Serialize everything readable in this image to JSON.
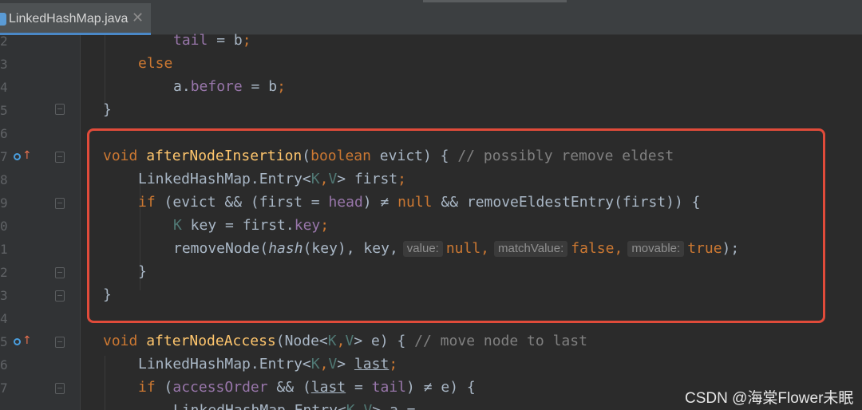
{
  "tab": {
    "title": "LinkedHashMap.java",
    "close_glyph": "✕",
    "icon": "java-class-icon"
  },
  "gutter": {
    "line_numbers": [
      "2",
      "3",
      "4",
      "5",
      "6",
      "7",
      "8",
      "9",
      "0",
      "1",
      "2",
      "3",
      "4",
      "5",
      "6",
      "7"
    ],
    "override_markers": [
      "override-marker-icon",
      "override-marker-icon"
    ]
  },
  "code": {
    "l1": {
      "t1": "tail",
      "t2": " = b",
      "t3": ";"
    },
    "l2": {
      "t1": "else"
    },
    "l3": {
      "t1": "a.",
      "t2": "before",
      "t3": " = b",
      "t4": ";"
    },
    "l4": {
      "t1": "}"
    },
    "l5": {
      "kw": "void ",
      "fn": "afterNodeInsertion",
      "t1": "(",
      "kw2": "boolean",
      "t2": " evict) { ",
      "cm": "// possibly remove eldest"
    },
    "l6": {
      "t1": "LinkedHashMap.Entry<",
      "tp1": "K",
      "t2": ",",
      "tp2": "V",
      "t3": "> first",
      "t4": ";"
    },
    "l7": {
      "kw": "if",
      "t1": " (evict && (first = ",
      "fld": "head",
      "t2": ") ≠ ",
      "kw2": "null",
      "t3": " && removeEldestEntry(first)) {"
    },
    "l8": {
      "tp": "K",
      "t1": " key = first.",
      "fld": "key",
      "t2": ";"
    },
    "l9": {
      "t1": "removeNode(",
      "it": "hash",
      "t2": "(key), key,",
      "hint1": "value:",
      "v1": "null,",
      "hint2": "matchValue:",
      "v2": "false,",
      "hint3": "movable:",
      "v3": "true",
      "t3": ");"
    },
    "l10": {
      "t1": "}"
    },
    "l11": {
      "t1": "}"
    },
    "l12": {
      "kw": "void ",
      "fn": "afterNodeAccess",
      "t1": "(Node<",
      "tp1": "K",
      "t2": ",",
      "tp2": "V",
      "t3": "> e) { ",
      "cm": "// move node to last"
    },
    "l13": {
      "t1": "LinkedHashMap.Entry<",
      "tp1": "K",
      "t2": ",",
      "tp2": "V",
      "t3": "> ",
      "ul": "last",
      "t4": ";"
    },
    "l14": {
      "kw": "if",
      "t1": " (",
      "fld": "accessOrder",
      "t2": " && (",
      "ul": "last",
      "t3": " = ",
      "fld2": "tail",
      "t4": ") ≠ e) {"
    },
    "l15": {
      "t1": "LinkedHashMap.Entry<",
      "tp1": "K",
      "t2": ",",
      "tp2": "V",
      "t3": "> a ="
    }
  },
  "colors": {
    "highlight_box": "#e04b3a",
    "keyword": "#cc7832",
    "method": "#ffc66d",
    "field": "#9876aa",
    "comment": "#808080"
  },
  "watermark": "CSDN @海棠Flower未眠"
}
